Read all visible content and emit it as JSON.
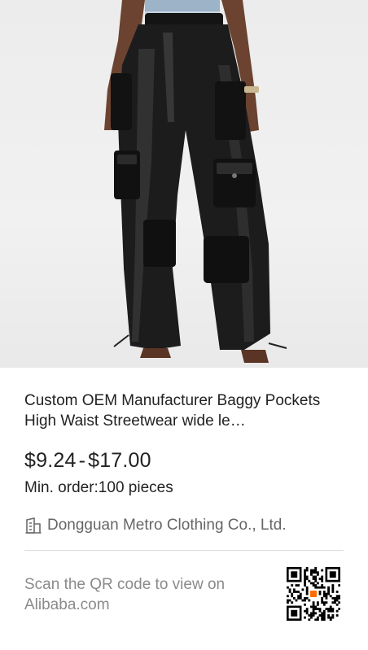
{
  "product": {
    "image_alt": "Black faux leather high waist baggy cargo pants",
    "title": "Custom OEM Manufacturer Baggy Pockets High Waist Streetwear wide le…",
    "price_min": "$9.24",
    "price_separator": "-",
    "price_max": "$17.00",
    "min_order": "Min. order:100 pieces"
  },
  "supplier": {
    "icon": "building-icon",
    "name": "Dongguan Metro Clothing Co., Ltd."
  },
  "footer": {
    "scan_text": "Scan the QR code to view on Alibaba.com",
    "qr_icon": "qr-code-icon",
    "qr_accent_color": "#ff6a00"
  }
}
